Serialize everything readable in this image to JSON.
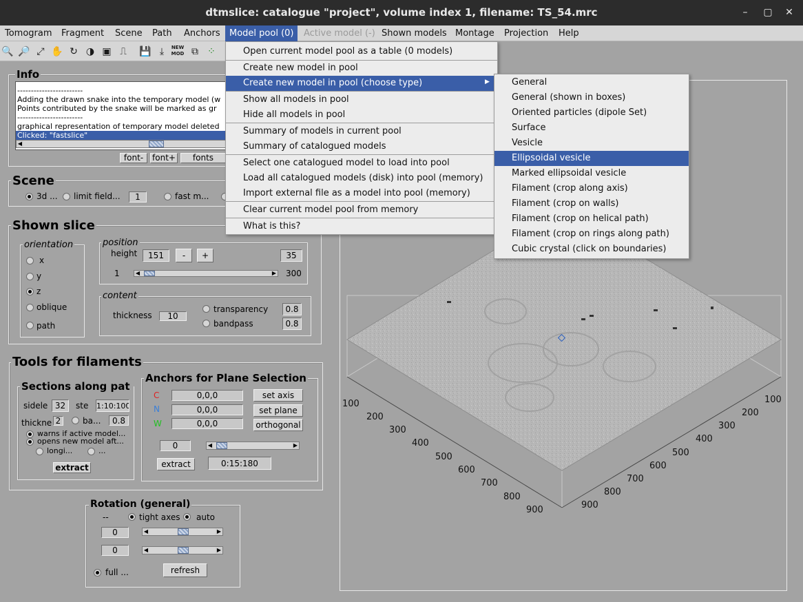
{
  "window": {
    "title": "dtmslice: catalogue \"project\", volume index 1, filename: TS_54.mrc",
    "controls": [
      "–",
      "▢",
      "✕"
    ]
  },
  "menubar": [
    "Tomogram",
    "Fragment",
    "Scene",
    "Path",
    "Anchors",
    "Model pool (0)",
    "Active model (-)",
    "Shown models",
    "Montage",
    "Projection",
    "Help"
  ],
  "toolbar": {
    "icons": [
      "zoom-in-icon",
      "zoom-out-icon",
      "fit-icon",
      "pan-hand-icon",
      "rotate-icon",
      "contrast-icon",
      "invert-icon",
      "threshold-icon",
      "save-icon",
      "load-icon",
      "new-model-icon",
      "duplicate-icon",
      "points-icon"
    ],
    "new_mod_label": "NEW MOD"
  },
  "info": {
    "title": "Info",
    "lines": [
      "------------------------",
      "Adding the drawn snake into the temporary model (w",
      "Points contributed by the snake will be marked as gr",
      "------------------------",
      "graphical representation of temporary model deleted",
      "Clicked: \"fastslice\""
    ],
    "font_minus": "font-",
    "font_plus": "font+",
    "fonts": "fonts"
  },
  "scene": {
    "title": "Scene",
    "opt_3d": "3d ...",
    "opt_limit": "limit field...",
    "limit_value": "1",
    "opt_fast": "fast m..."
  },
  "shown_slice": {
    "title": "Shown slice",
    "orientation_title": "orientation",
    "orientations": [
      "x",
      "y",
      "z",
      "oblique",
      "path"
    ],
    "selected_orientation": "z",
    "position_title": "position",
    "height_label": "height",
    "height_value": "151",
    "minus": "-",
    "plus": "+",
    "step_value": "35",
    "range_min": "1",
    "range_max": "300",
    "content_title": "content",
    "thickness_label": "thickness",
    "thickness_value": "10",
    "transparency_label": "transparency",
    "transparency_value": "0.8",
    "bandpass_label": "bandpass",
    "bandpass_value": "0.8"
  },
  "filaments": {
    "title": "Tools for filaments",
    "sections_title": "Sections along pat",
    "sidele_label": "sidele",
    "sidele_value": "32",
    "ste_label": "ste",
    "ste_value": "1:10:100",
    "thickne_label": "thickne",
    "thickne_value": "2",
    "ba_label": "ba...",
    "ba_value": "0.8",
    "warns_label": "warns if active model...",
    "opens_label": "opens new model aft...",
    "longi_label": "longi...",
    "dots_label": "...",
    "extract_label": "extract",
    "anchors_title": "Anchors for Plane Selection",
    "anchor_letters": [
      "C",
      "N",
      "W"
    ],
    "anchor_colors": [
      "#e02020",
      "#3a7fd8",
      "#20c020"
    ],
    "anchor_values": [
      "0,0,0",
      "0,0,0",
      "0,0,0"
    ],
    "set_axis": "set axis",
    "set_plane": "set plane",
    "orthogonal": "orthogonal",
    "angle_value": "0",
    "extract2_label": "extract",
    "range_value": "0:15:180"
  },
  "rotation": {
    "title": "Rotation (general)",
    "dash": "--",
    "tight_axes": "tight axes",
    "auto": "auto",
    "value1": "0",
    "value2": "0",
    "full_label": "full ...",
    "refresh": "refresh"
  },
  "view3d": {
    "left_ticks": [
      "100",
      "200",
      "300",
      "400",
      "500",
      "600",
      "700",
      "800",
      "900"
    ],
    "right_ticks": [
      "100",
      "200",
      "300",
      "400",
      "500",
      "600",
      "700",
      "800",
      "900"
    ]
  },
  "dropdown": {
    "items": [
      "Open current model pool as a table (0 models)",
      "Create new model in pool",
      "Create new model in pool (choose type)",
      "Show all models in pool",
      "Hide all models in pool",
      "Summary of models in current pool",
      "Summary of catalogued models",
      "Select one catalogued model to load into pool",
      "Load all catalogued models (disk) into pool (memory)",
      "Import external file as a model into pool (memory)",
      "Clear current model pool from memory",
      "What is this?"
    ],
    "submenu_arrow": "▶"
  },
  "submenu": {
    "items": [
      "General",
      "General (shown in boxes)",
      "Oriented particles (dipole Set)",
      "Surface",
      "Vesicle",
      "Ellipsoidal vesicle",
      "Marked ellipsoidal vesicle",
      "Filament (crop along axis)",
      "Filament (crop on walls)",
      "Filament (crop on helical path)",
      "Filament (crop on rings along path)",
      "Cubic crystal (click on boundaries)"
    ]
  }
}
